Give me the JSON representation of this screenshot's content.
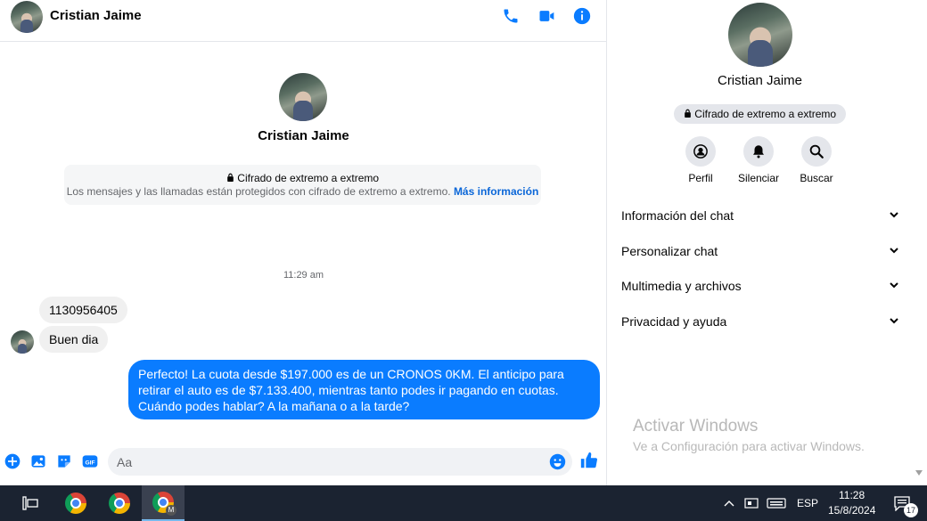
{
  "contact": {
    "name": "Cristian Jaime"
  },
  "header": {
    "call_icon": "phone-icon",
    "video_icon": "video-camera-icon",
    "info_icon": "info-icon"
  },
  "chat": {
    "intro_name": "Cristian Jaime",
    "encryption_title": "Cifrado de extremo a extremo",
    "encryption_desc": "Los mensajes y las llamadas están protegidos con cifrado de extremo a extremo.",
    "encryption_link": "Más información",
    "timestamp": "11:29 am",
    "messages": [
      {
        "direction": "in",
        "text": "1130956405"
      },
      {
        "direction": "in",
        "text": "Buen dia"
      },
      {
        "direction": "out",
        "text": "Perfecto! La cuota desde $197.000 es de un CRONOS 0KM. El anticipo para retirar el auto es de $7.133.400, mientras tanto podes ir pagando en cuotas. Cuándo podes hablar? A la mañana o a la tarde?"
      }
    ]
  },
  "composer": {
    "placeholder": "Aa",
    "gif_label": "GIF"
  },
  "panel": {
    "name": "Cristian Jaime",
    "badge": "Cifrado de extremo a extremo",
    "actions": [
      {
        "label": "Perfil",
        "icon": "profile-icon"
      },
      {
        "label": "Silenciar",
        "icon": "bell-icon"
      },
      {
        "label": "Buscar",
        "icon": "search-icon"
      }
    ],
    "sections": [
      {
        "label": "Información del chat"
      },
      {
        "label": "Personalizar chat"
      },
      {
        "label": "Multimedia y archivos"
      },
      {
        "label": "Privacidad y ayuda"
      }
    ]
  },
  "watermark": {
    "title": "Activar Windows",
    "subtitle": "Ve a Configuración para activar Windows."
  },
  "taskbar": {
    "language": "ESP",
    "time": "11:28",
    "date": "15/8/2024",
    "notification_count": "17",
    "active_badge": "M"
  },
  "colors": {
    "accent": "#0a7cff",
    "outgoing_bubble": "#0a7cff",
    "incoming_bubble": "#f0f0f0",
    "taskbar": "#1b2331"
  }
}
